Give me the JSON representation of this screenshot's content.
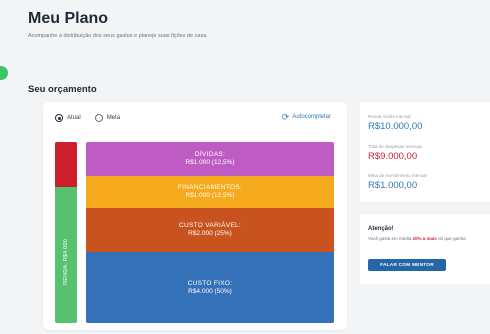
{
  "header": {
    "title": "Meu Plano",
    "subtitle": "Acompanhe a distribuição dos seus gastos e planeje suas fições de casa."
  },
  "section": {
    "title": "Seu orçamento"
  },
  "budget": {
    "options": [
      {
        "label": "Atual",
        "selected": true
      },
      {
        "label": "Meta",
        "selected": false
      }
    ],
    "autocomplete_label": "Autocompletar",
    "autocomplete_icon": "refresh-icon",
    "renda_label": "RENDA: R$4.000",
    "segments": [
      {
        "name": "DÍVIDAS:",
        "value": "R$1.000 (12,5%)",
        "color": "#bf5cc4"
      },
      {
        "name": "FINANCIAMENTOS:",
        "value": "R$1.000 (12,5%)",
        "color": "#f5a91c"
      },
      {
        "name": "CUSTO VARIÁVEL:",
        "value": "R$2.000 (25%)",
        "color": "#c8531f"
      },
      {
        "name": "CUSTO FIXO:",
        "value": "R$4.000 (50%)",
        "color": "#3471b8"
      }
    ],
    "renda_color": "#56c26f",
    "deficit_color": "#cc1f2e"
  },
  "metrics": [
    {
      "label": "Renda média mensal",
      "value": "R$10.000,00",
      "tone": "blue"
    },
    {
      "label": "Total de despesas mensais",
      "value": "R$9.000,00",
      "tone": "red"
    },
    {
      "label": "Meta de investimento mensal",
      "value": "R$1.000,00",
      "tone": "blue"
    }
  ],
  "alert": {
    "title": "Atenção!",
    "text_before": "Você gasta em média ",
    "highlight": "20% a mais",
    "text_after": " do que ganha",
    "button_label": "FALAR COM MENTOR"
  }
}
